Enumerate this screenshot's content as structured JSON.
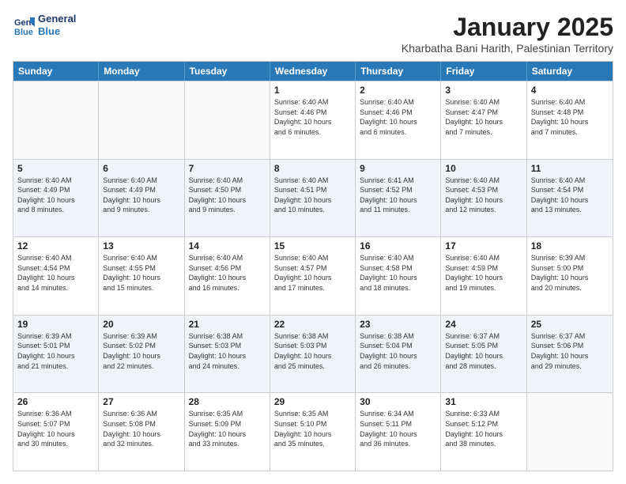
{
  "logo": {
    "line1": "General",
    "line2": "Blue"
  },
  "title": "January 2025",
  "subtitle": "Kharbatha Bani Harith, Palestinian Territory",
  "header_days": [
    "Sunday",
    "Monday",
    "Tuesday",
    "Wednesday",
    "Thursday",
    "Friday",
    "Saturday"
  ],
  "weeks": [
    [
      {
        "day": "",
        "info": ""
      },
      {
        "day": "",
        "info": ""
      },
      {
        "day": "",
        "info": ""
      },
      {
        "day": "1",
        "info": "Sunrise: 6:40 AM\nSunset: 4:46 PM\nDaylight: 10 hours\nand 6 minutes."
      },
      {
        "day": "2",
        "info": "Sunrise: 6:40 AM\nSunset: 4:46 PM\nDaylight: 10 hours\nand 6 minutes."
      },
      {
        "day": "3",
        "info": "Sunrise: 6:40 AM\nSunset: 4:47 PM\nDaylight: 10 hours\nand 7 minutes."
      },
      {
        "day": "4",
        "info": "Sunrise: 6:40 AM\nSunset: 4:48 PM\nDaylight: 10 hours\nand 7 minutes."
      }
    ],
    [
      {
        "day": "5",
        "info": "Sunrise: 6:40 AM\nSunset: 4:49 PM\nDaylight: 10 hours\nand 8 minutes."
      },
      {
        "day": "6",
        "info": "Sunrise: 6:40 AM\nSunset: 4:49 PM\nDaylight: 10 hours\nand 9 minutes."
      },
      {
        "day": "7",
        "info": "Sunrise: 6:40 AM\nSunset: 4:50 PM\nDaylight: 10 hours\nand 9 minutes."
      },
      {
        "day": "8",
        "info": "Sunrise: 6:40 AM\nSunset: 4:51 PM\nDaylight: 10 hours\nand 10 minutes."
      },
      {
        "day": "9",
        "info": "Sunrise: 6:41 AM\nSunset: 4:52 PM\nDaylight: 10 hours\nand 11 minutes."
      },
      {
        "day": "10",
        "info": "Sunrise: 6:40 AM\nSunset: 4:53 PM\nDaylight: 10 hours\nand 12 minutes."
      },
      {
        "day": "11",
        "info": "Sunrise: 6:40 AM\nSunset: 4:54 PM\nDaylight: 10 hours\nand 13 minutes."
      }
    ],
    [
      {
        "day": "12",
        "info": "Sunrise: 6:40 AM\nSunset: 4:54 PM\nDaylight: 10 hours\nand 14 minutes."
      },
      {
        "day": "13",
        "info": "Sunrise: 6:40 AM\nSunset: 4:55 PM\nDaylight: 10 hours\nand 15 minutes."
      },
      {
        "day": "14",
        "info": "Sunrise: 6:40 AM\nSunset: 4:56 PM\nDaylight: 10 hours\nand 16 minutes."
      },
      {
        "day": "15",
        "info": "Sunrise: 6:40 AM\nSunset: 4:57 PM\nDaylight: 10 hours\nand 17 minutes."
      },
      {
        "day": "16",
        "info": "Sunrise: 6:40 AM\nSunset: 4:58 PM\nDaylight: 10 hours\nand 18 minutes."
      },
      {
        "day": "17",
        "info": "Sunrise: 6:40 AM\nSunset: 4:59 PM\nDaylight: 10 hours\nand 19 minutes."
      },
      {
        "day": "18",
        "info": "Sunrise: 6:39 AM\nSunset: 5:00 PM\nDaylight: 10 hours\nand 20 minutes."
      }
    ],
    [
      {
        "day": "19",
        "info": "Sunrise: 6:39 AM\nSunset: 5:01 PM\nDaylight: 10 hours\nand 21 minutes."
      },
      {
        "day": "20",
        "info": "Sunrise: 6:39 AM\nSunset: 5:02 PM\nDaylight: 10 hours\nand 22 minutes."
      },
      {
        "day": "21",
        "info": "Sunrise: 6:38 AM\nSunset: 5:03 PM\nDaylight: 10 hours\nand 24 minutes."
      },
      {
        "day": "22",
        "info": "Sunrise: 6:38 AM\nSunset: 5:03 PM\nDaylight: 10 hours\nand 25 minutes."
      },
      {
        "day": "23",
        "info": "Sunrise: 6:38 AM\nSunset: 5:04 PM\nDaylight: 10 hours\nand 26 minutes."
      },
      {
        "day": "24",
        "info": "Sunrise: 6:37 AM\nSunset: 5:05 PM\nDaylight: 10 hours\nand 28 minutes."
      },
      {
        "day": "25",
        "info": "Sunrise: 6:37 AM\nSunset: 5:06 PM\nDaylight: 10 hours\nand 29 minutes."
      }
    ],
    [
      {
        "day": "26",
        "info": "Sunrise: 6:36 AM\nSunset: 5:07 PM\nDaylight: 10 hours\nand 30 minutes."
      },
      {
        "day": "27",
        "info": "Sunrise: 6:36 AM\nSunset: 5:08 PM\nDaylight: 10 hours\nand 32 minutes."
      },
      {
        "day": "28",
        "info": "Sunrise: 6:35 AM\nSunset: 5:09 PM\nDaylight: 10 hours\nand 33 minutes."
      },
      {
        "day": "29",
        "info": "Sunrise: 6:35 AM\nSunset: 5:10 PM\nDaylight: 10 hours\nand 35 minutes."
      },
      {
        "day": "30",
        "info": "Sunrise: 6:34 AM\nSunset: 5:11 PM\nDaylight: 10 hours\nand 36 minutes."
      },
      {
        "day": "31",
        "info": "Sunrise: 6:33 AM\nSunset: 5:12 PM\nDaylight: 10 hours\nand 38 minutes."
      },
      {
        "day": "",
        "info": ""
      }
    ]
  ]
}
